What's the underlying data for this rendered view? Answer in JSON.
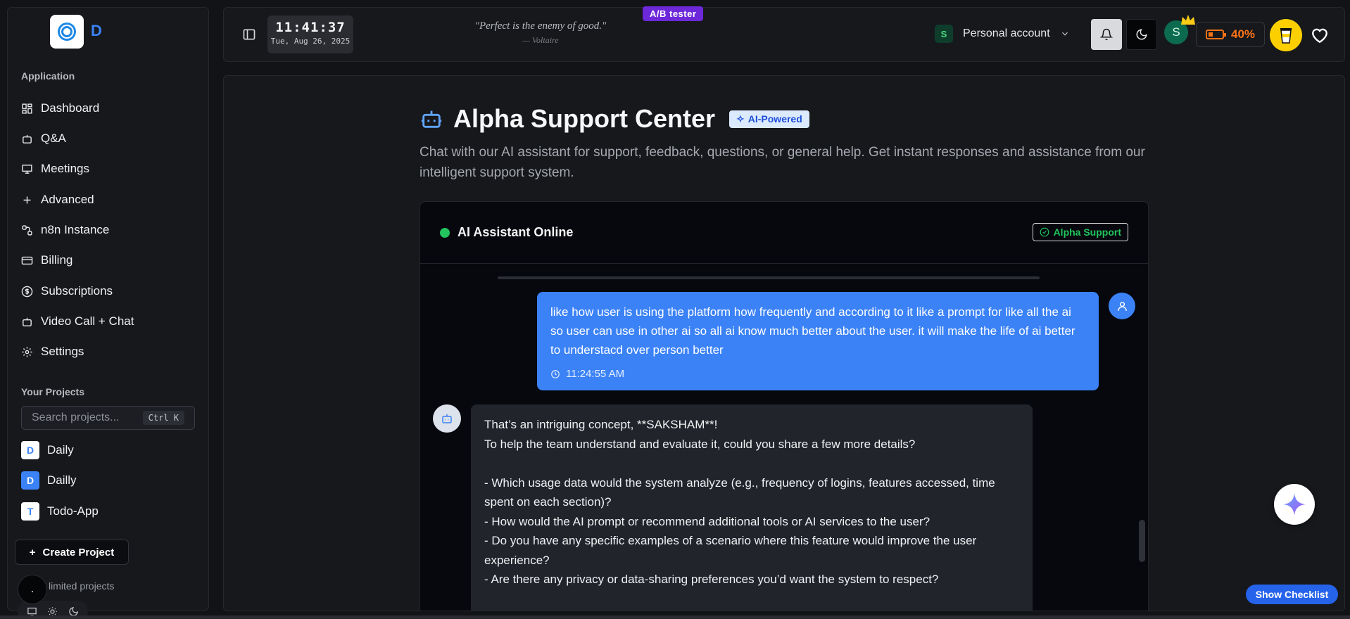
{
  "app": {
    "logo_letter": "D"
  },
  "sidebar": {
    "application_label": "Application",
    "items": [
      {
        "label": "Dashboard",
        "icon": "dashboard-icon"
      },
      {
        "label": "Q&A",
        "icon": "bot-icon"
      },
      {
        "label": "Meetings",
        "icon": "presentation-icon"
      },
      {
        "label": "Advanced",
        "icon": "plus-icon"
      },
      {
        "label": "n8n Instance",
        "icon": "workflow-icon"
      },
      {
        "label": "Billing",
        "icon": "credit-card-icon"
      },
      {
        "label": "Subscriptions",
        "icon": "dollar-circle-icon"
      },
      {
        "label": "Video Call + Chat",
        "icon": "bot-icon"
      },
      {
        "label": "Settings",
        "icon": "gear-icon"
      }
    ],
    "projects_label": "Your Projects",
    "search": {
      "placeholder": "Search projects...",
      "shortcut": "Ctrl K"
    },
    "projects": [
      {
        "letter": "D",
        "name": "Daily"
      },
      {
        "letter": "D",
        "name": "Dailly"
      },
      {
        "letter": "T",
        "name": "Todo-App"
      }
    ],
    "create_label": "Create Project",
    "unlimited_label": "limited projects",
    "dark_dot": "."
  },
  "topbar": {
    "time": "11:41:37",
    "date": "Tue, Aug 26, 2025",
    "ab_badge": "A/B tester",
    "quote": "\"Perfect is the enemy of good.\"",
    "quote_author": "— Voltaire",
    "account_letter": "S",
    "account_label": "Personal account",
    "avatar_letter": "S",
    "battery": "40%"
  },
  "main": {
    "title": "Alpha Support Center",
    "ai_badge": "AI-Powered",
    "subtitle": "Chat with our AI assistant for support, feedback, questions, or general help. Get instant responses and assistance from our intelligent support system."
  },
  "chat": {
    "status": "AI Assistant Online",
    "badge": "Alpha Support",
    "user_message": "like how user is using the platform how frequently and according to it like a prompt for like all the ai so user can use in other ai so all ai know much better about the user. it will make the life of ai better to understacd over person better",
    "user_time": "11:24:55 AM",
    "bot_message": "That’s an intriguing concept, **SAKSHAM**!\nTo help the team understand and evaluate it, could you share a few more details?\n\n- Which usage data would the system analyze (e.g., frequency of logins, features accessed, time spent on each section)?\n- How would the AI prompt or recommend additional tools or AI services to the user?\n- Do you have any specific examples of a scenario where this feature would improve the user experience?\n- Are there any privacy or data-sharing preferences you’d want the system to respect?"
  },
  "checklist_label": "Show Checklist",
  "colors": {
    "accent": "#3b82f6",
    "online": "#22c55e",
    "battery": "#f97316",
    "ab": "#6d28d9"
  }
}
